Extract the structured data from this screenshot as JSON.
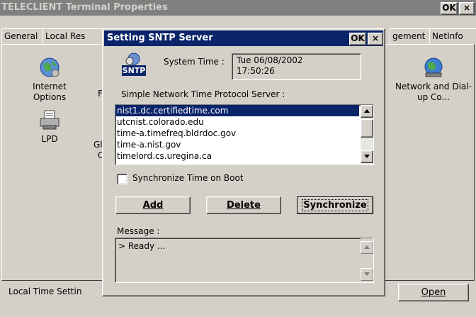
{
  "main_window": {
    "title": "TELECLIENT Terminal Properties",
    "ok_label": "OK",
    "close_label": "×",
    "tabs": [
      "General",
      "Local Res",
      "gement",
      "NetInfo"
    ],
    "icons": [
      {
        "label": "Internet Options",
        "icon": "globe-settings-icon"
      },
      {
        "label": "LPD",
        "icon": "printer-icon"
      },
      {
        "label": "Network and Dial-up Co...",
        "icon": "network-globe-icon"
      }
    ],
    "partial_labels": [
      "F",
      "Gl",
      "Cl"
    ],
    "status_text": "Local Time Settin",
    "open_button": "Open"
  },
  "dialog": {
    "title": "Setting SNTP Server",
    "ok_label": "OK",
    "close_label": "×",
    "sntp_icon_text": "SNTP",
    "system_time_label": "System Time :",
    "system_time_value_line1": "Tue 06/08/2002",
    "system_time_value_line2": "17:50:26",
    "server_list_label": "Simple Network Time Protocol Server :",
    "servers": [
      "nist1.dc.certifiedtime.com",
      "utcnist.colorado.edu",
      "time-a.timefreq.bldrdoc.gov",
      "time-a.nist.gov",
      "timelord.cs.uregina.ca"
    ],
    "selected_server_index": 0,
    "sync_on_boot_label": "Synchronize Time on Boot",
    "sync_on_boot_checked": false,
    "add_button": "Add",
    "delete_button": "Delete",
    "synchronize_button": "Synchronize",
    "message_label": "Message :",
    "message_text": "> Ready ..."
  },
  "colors": {
    "title_active": "#0a246a",
    "title_inactive": "#808080",
    "selection": "#0a246a",
    "face": "#d4d0c8"
  }
}
